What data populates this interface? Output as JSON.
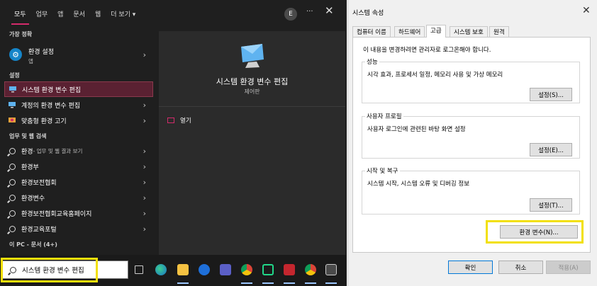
{
  "search_panel": {
    "tabs": [
      "모두",
      "업무",
      "앱",
      "문서",
      "웹",
      "더 보기 ▾"
    ],
    "avatar_initial": "E",
    "more": "···",
    "close": "✕",
    "best_match_label": "가장 정확",
    "best_match": {
      "title": "환경 설정",
      "subtitle": "앱"
    },
    "settings_label": "설정",
    "settings_items": [
      "시스템 환경 변수 편집",
      "계정의 환경 변수 편집",
      "맞춤형 환경 고기"
    ],
    "web_label": "업무 및 웹 검색",
    "web_items": [
      {
        "main": "환경",
        "sub": " - 업무 및 웹 결과 보기"
      },
      {
        "main": "환경부",
        "sub": ""
      },
      {
        "main": "환경보전협회",
        "sub": ""
      },
      {
        "main": "환경변수",
        "sub": ""
      },
      {
        "main": "환경보전협회교육홈페이지",
        "sub": ""
      },
      {
        "main": "환경교육포털",
        "sub": ""
      }
    ],
    "pc_docs_label": "이 PC - 문서 (4+)",
    "preview": {
      "title": "시스템 환경 변수 편집",
      "subtitle": "제어판",
      "open_label": "열기"
    },
    "search_value": "시스템 환경 변수 편집",
    "taskbar_icons": [
      "task-view-icon",
      "edge-icon",
      "file-explorer-icon",
      "onedrive-icon",
      "teams-icon",
      "chrome-icon",
      "pycharm-icon",
      "red-app-icon",
      "chrome-icon",
      "photos-icon"
    ]
  },
  "dialog": {
    "title": "시스템 속성",
    "close": "✕",
    "tabs": [
      "컴퓨터 이름",
      "하드웨어",
      "고급",
      "시스템 보호",
      "원격"
    ],
    "active_tab": "고급",
    "info": "이 내용을 변경하려면 관리자로 로그온해야 합니다.",
    "groups": [
      {
        "label": "성능",
        "text": "시각 효과, 프로세서 일정, 메모리 사용 및 가상 메모리",
        "button": "설정(S)..."
      },
      {
        "label": "사용자 프로필",
        "text": "사용자 로그인에 관련된 바탕 화면 설정",
        "button": "설정(E)..."
      },
      {
        "label": "시작 및 복구",
        "text": "시스템 시작, 시스템 오류 및 디버깅 정보",
        "button": "설정(T)..."
      }
    ],
    "env_button": "환경 변수(N)...",
    "ok": "확인",
    "cancel": "취소",
    "apply": "적용(A)"
  },
  "colors": {
    "accent": "#d42b6b",
    "highlight": "#f2e00a",
    "selected_row": "#5a2132"
  }
}
